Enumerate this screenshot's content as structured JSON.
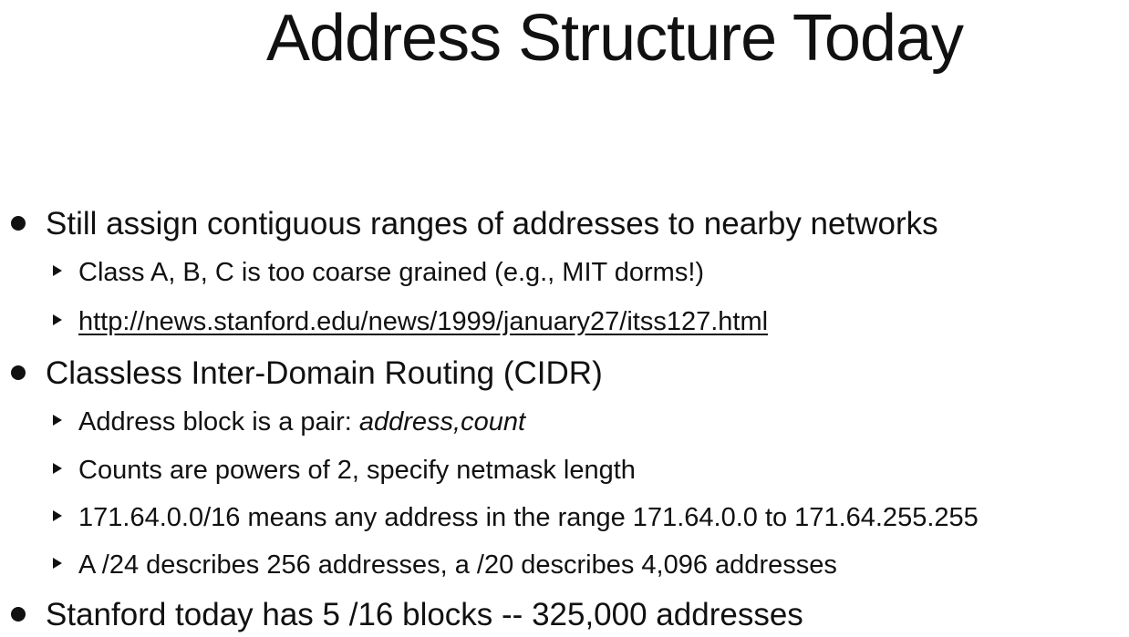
{
  "slide": {
    "title": "Address Structure Today",
    "bullets": [
      {
        "text": "Still assign contiguous ranges of addresses to nearby networks",
        "sub": [
          {
            "text": "Class A, B, C is too coarse grained (e.g., MIT dorms!)"
          },
          {
            "link": "http://news.stanford.edu/news/1999/january27/itss127.html"
          }
        ]
      },
      {
        "text": "Classless Inter-Domain Routing (CIDR)",
        "sub": [
          {
            "prefix": "Address block is a pair: ",
            "italic": "address,count"
          },
          {
            "text": "Counts are powers of 2, specify netmask length"
          },
          {
            "text": "171.64.0.0/16 means any address in the range 171.64.0.0 to 171.64.255.255"
          },
          {
            "text": "A /24 describes 256 addresses, a /20 describes 4,096 addresses"
          }
        ]
      },
      {
        "text": "Stanford today has 5 /16 blocks -- 325,000 addresses"
      }
    ]
  }
}
